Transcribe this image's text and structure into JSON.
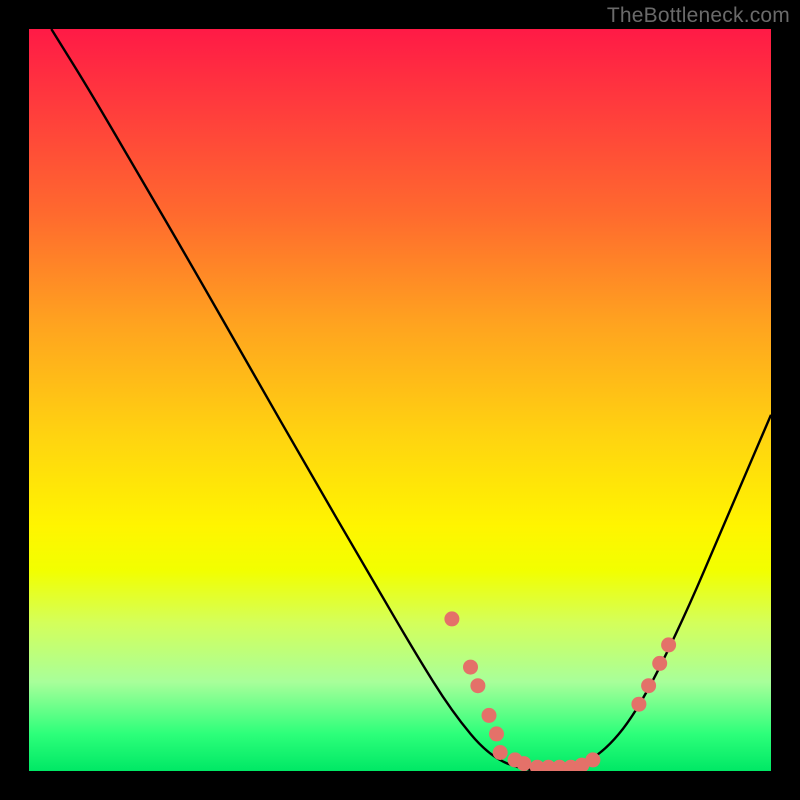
{
  "watermark": "TheBottleneck.com",
  "chart_data": {
    "type": "line",
    "title": "",
    "xlabel": "",
    "ylabel": "",
    "xlim": [
      0,
      100
    ],
    "ylim": [
      0,
      100
    ],
    "grid": false,
    "curve_points": [
      {
        "x": 3,
        "y": 100
      },
      {
        "x": 8,
        "y": 92
      },
      {
        "x": 15,
        "y": 80
      },
      {
        "x": 22,
        "y": 68
      },
      {
        "x": 30,
        "y": 54
      },
      {
        "x": 38,
        "y": 40
      },
      {
        "x": 45,
        "y": 28
      },
      {
        "x": 52,
        "y": 16
      },
      {
        "x": 57,
        "y": 8
      },
      {
        "x": 62,
        "y": 2
      },
      {
        "x": 67,
        "y": 0
      },
      {
        "x": 72,
        "y": 0
      },
      {
        "x": 77,
        "y": 2
      },
      {
        "x": 82,
        "y": 8
      },
      {
        "x": 88,
        "y": 20
      },
      {
        "x": 94,
        "y": 34
      },
      {
        "x": 100,
        "y": 48
      }
    ],
    "scatter_points": [
      {
        "x": 57,
        "y": 20.5
      },
      {
        "x": 59.5,
        "y": 14
      },
      {
        "x": 60.5,
        "y": 11.5
      },
      {
        "x": 62,
        "y": 7.5
      },
      {
        "x": 63,
        "y": 5
      },
      {
        "x": 63.5,
        "y": 2.5
      },
      {
        "x": 65.5,
        "y": 1.5
      },
      {
        "x": 66.7,
        "y": 1
      },
      {
        "x": 68.5,
        "y": 0.5
      },
      {
        "x": 70,
        "y": 0.5
      },
      {
        "x": 71.5,
        "y": 0.5
      },
      {
        "x": 73,
        "y": 0.5
      },
      {
        "x": 74.5,
        "y": 0.8
      },
      {
        "x": 76,
        "y": 1.5
      },
      {
        "x": 82.2,
        "y": 9
      },
      {
        "x": 83.5,
        "y": 11.5
      },
      {
        "x": 85,
        "y": 14.5
      },
      {
        "x": 86.2,
        "y": 17
      }
    ]
  }
}
